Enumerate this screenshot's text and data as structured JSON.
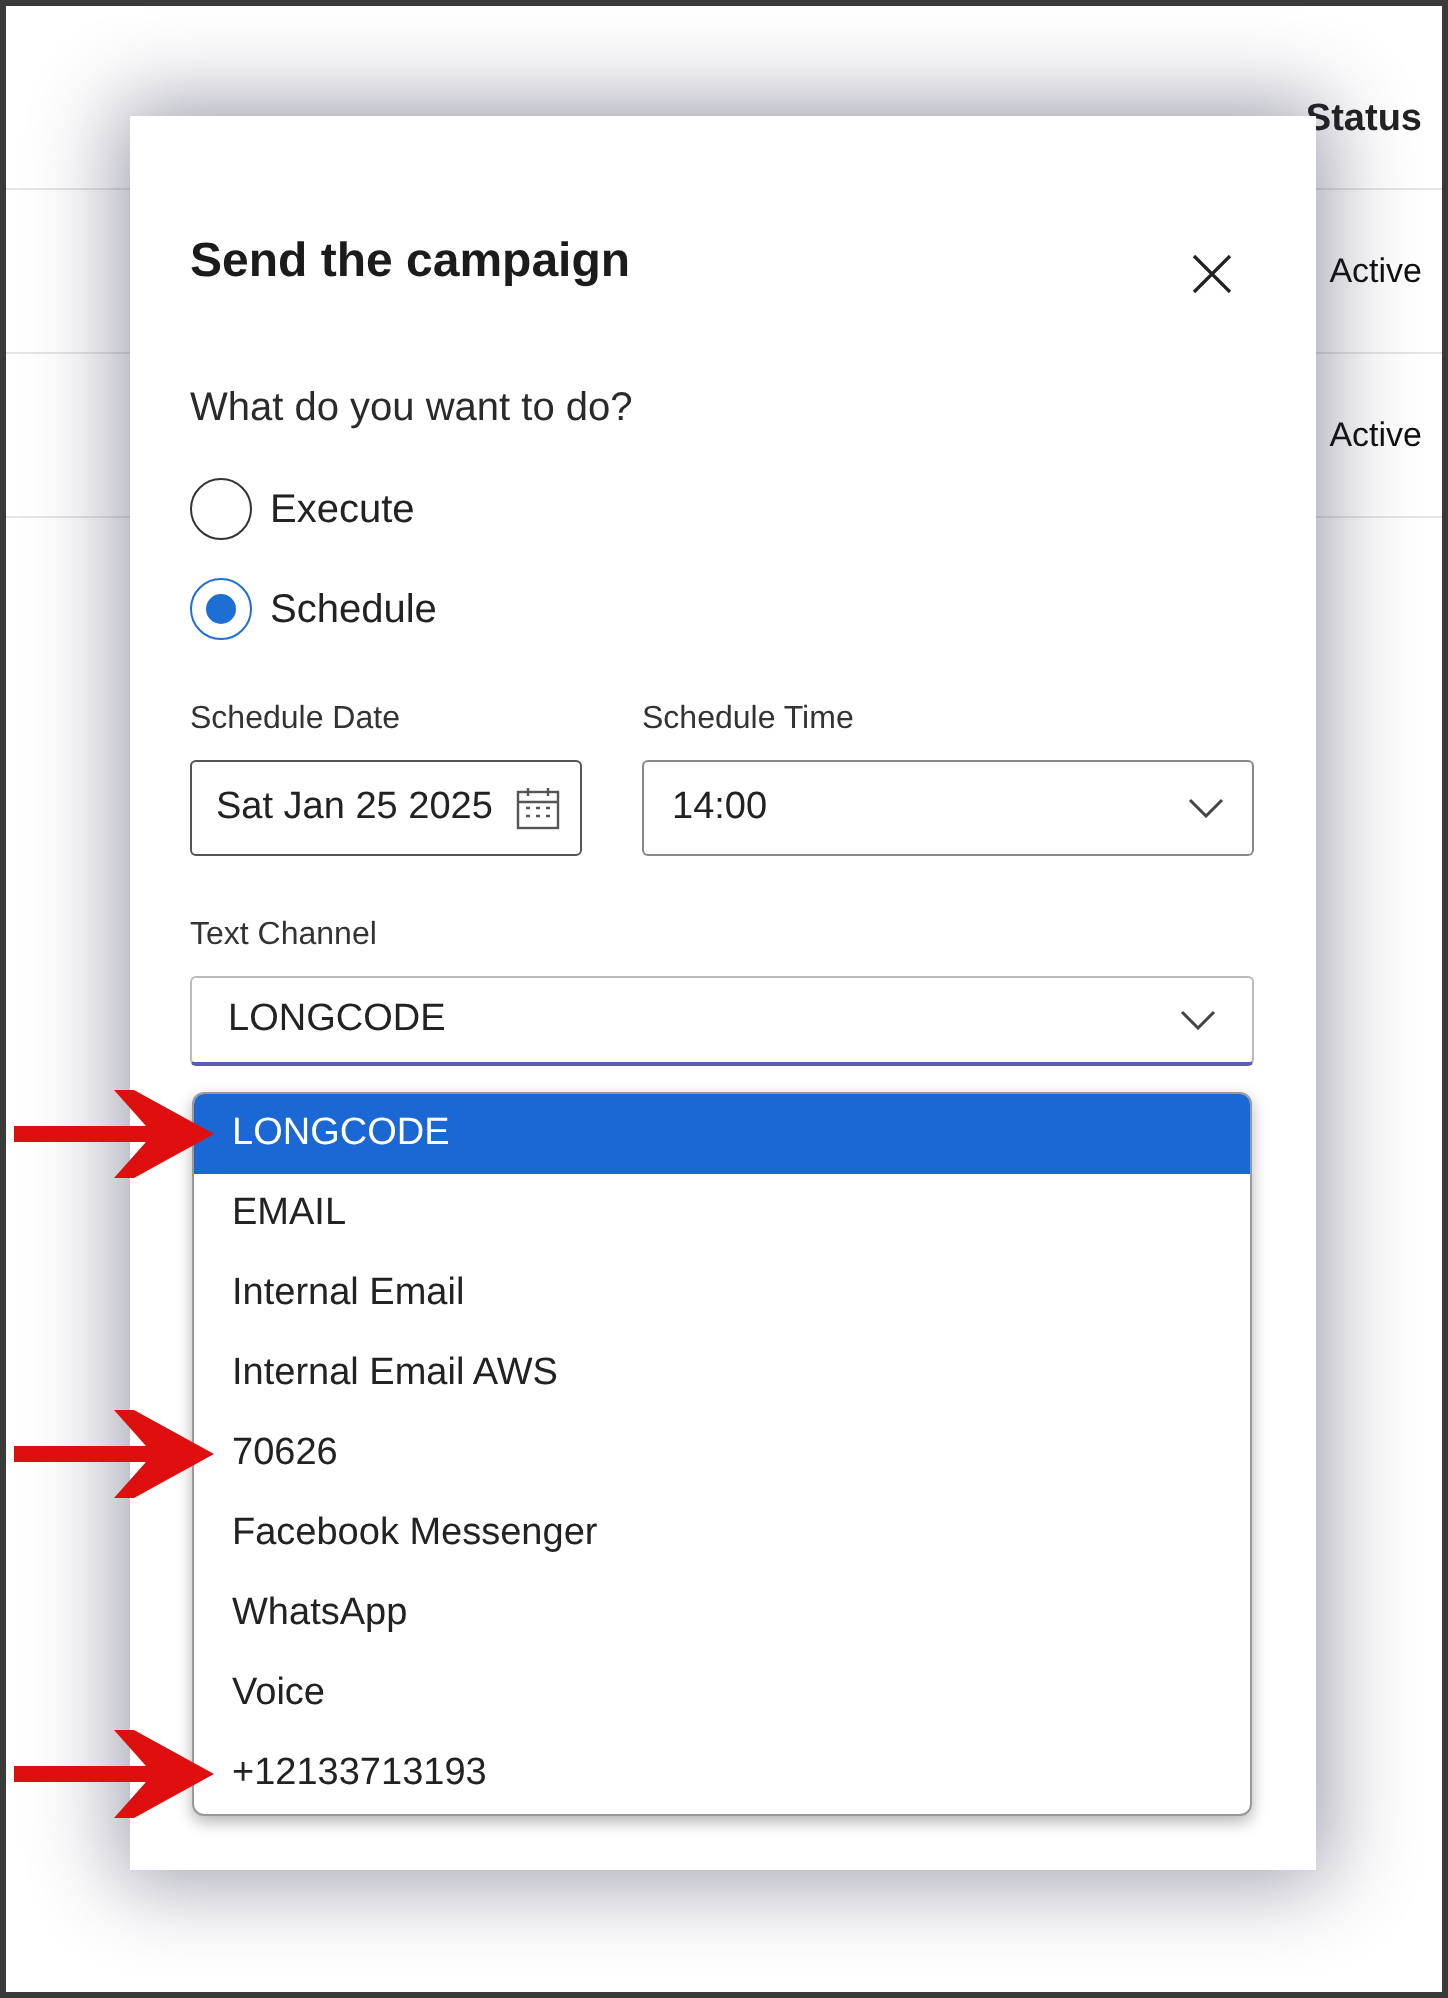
{
  "table": {
    "columns": [
      {
        "label": "Status"
      }
    ],
    "rows": [
      {
        "status": "Active"
      },
      {
        "status": "Active"
      }
    ]
  },
  "dialog": {
    "title": "Send the campaign",
    "question": "What do you want to do?",
    "options": [
      {
        "label": "Execute",
        "selected": false
      },
      {
        "label": "Schedule",
        "selected": true
      }
    ],
    "date": {
      "label": "Schedule Date",
      "value": "Sat Jan 25 2025"
    },
    "time": {
      "label": "Schedule Time",
      "value": "14:00"
    },
    "channel": {
      "label": "Text Channel",
      "value": "LONGCODE",
      "expanded": true,
      "items": [
        {
          "label": "LONGCODE",
          "selected": true,
          "annotated": true
        },
        {
          "label": "EMAIL",
          "selected": false,
          "annotated": false
        },
        {
          "label": "Internal Email",
          "selected": false,
          "annotated": false
        },
        {
          "label": "Internal Email AWS",
          "selected": false,
          "annotated": false
        },
        {
          "label": "70626",
          "selected": false,
          "annotated": true
        },
        {
          "label": "Facebook Messenger",
          "selected": false,
          "annotated": false
        },
        {
          "label": "WhatsApp",
          "selected": false,
          "annotated": false
        },
        {
          "label": "Voice",
          "selected": false,
          "annotated": false
        },
        {
          "label": "+12133713193",
          "selected": false,
          "annotated": true
        }
      ]
    }
  }
}
